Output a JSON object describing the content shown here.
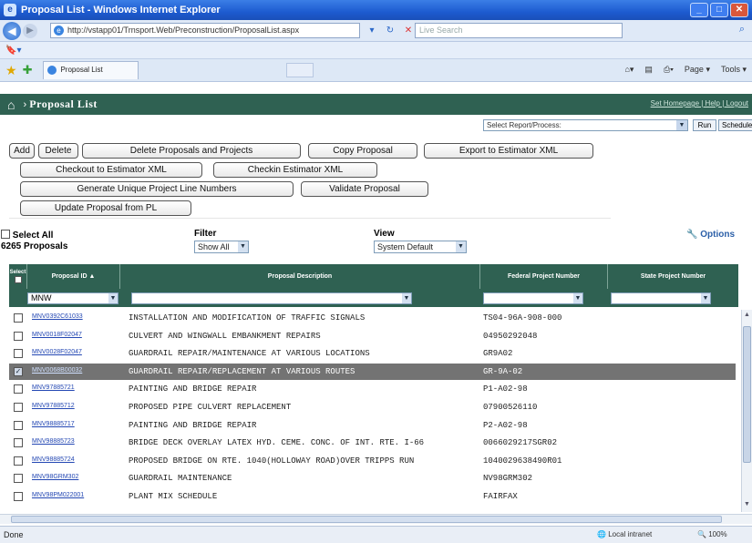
{
  "window": {
    "title": "Proposal List - Windows Internet Explorer",
    "address": "http://vstapp01/Trnsport.Web/Preconstruction/ProposalList.aspx",
    "search_placeholder": "Live Search",
    "tab_label": "Proposal List",
    "tools": [
      "Page ▾",
      "Tools ▾"
    ]
  },
  "app": {
    "title": "Proposal List",
    "header_links": "Set Homepage | Help | Logout",
    "report_select": "Select Report/Process:",
    "run_label": "Run",
    "schedule_label": "Schedule"
  },
  "actions": {
    "add": "Add",
    "delete": "Delete",
    "delete_proposals_projects": "Delete Proposals and Projects",
    "copy_proposal": "Copy Proposal",
    "export_estimator": "Export to Estimator XML",
    "checkout_estimator": "Checkout to Estimator XML",
    "checkin_estimator": "Checkin Estimator XML",
    "generate_line_numbers": "Generate Unique Project Line Numbers",
    "validate_proposal": "Validate Proposal",
    "update_from_pl": "Update Proposal from PL"
  },
  "controls": {
    "select_all": "Select All",
    "count": "6265 Proposals",
    "filter_label": "Filter",
    "filter_value": "Show All",
    "view_label": "View",
    "view_value": "System Default",
    "options": "Options"
  },
  "grid": {
    "headers": {
      "select": "Select",
      "proposal_id": "Proposal ID ▲",
      "description": "Proposal Description",
      "federal": "Federal Project Number",
      "state": "State Project Number"
    },
    "filter_proposal_id": "MNW",
    "rows": [
      {
        "id": "MNV0392C61033",
        "desc": "INSTALLATION AND MODIFICATION OF TRAFFIC SIGNALS",
        "fed": "TS04-96A-908-000",
        "state": "",
        "selected": false
      },
      {
        "id": "MNV0018F02047",
        "desc": "CULVERT AND WINGWALL EMBANKMENT REPAIRS",
        "fed": "04950292048",
        "state": "",
        "selected": false
      },
      {
        "id": "MNV0028F02047",
        "desc": "GUARDRAIL REPAIR/MAINTENANCE AT VARIOUS LOCATIONS",
        "fed": "GR9A02",
        "state": "",
        "selected": false
      },
      {
        "id": "MNV0068B00032",
        "desc": "GUARDRAIL REPAIR/REPLACEMENT AT VARIOUS ROUTES",
        "fed": "GR-9A-02",
        "state": "",
        "selected": true
      },
      {
        "id": "MNV97885721",
        "desc": "PAINTING AND BRIDGE REPAIR",
        "fed": "P1-A02-98",
        "state": "",
        "selected": false
      },
      {
        "id": "MNV97885712",
        "desc": "PROPOSED PIPE CULVERT REPLACEMENT",
        "fed": "07900526110",
        "state": "",
        "selected": false
      },
      {
        "id": "MNV98885717",
        "desc": "PAINTING AND BRIDGE REPAIR",
        "fed": "P2-A02-98",
        "state": "",
        "selected": false
      },
      {
        "id": "MNV98885723",
        "desc": "BRIDGE DECK OVERLAY LATEX HYD. CEME. CONC. OF INT. RTE. I-66",
        "fed": "0066029217SGR02",
        "state": "",
        "selected": false
      },
      {
        "id": "MNV98885724",
        "desc": "PROPOSED BRIDGE ON RTE. 1040(HOLLOWAY ROAD)OVER TRIPPS RUN",
        "fed": "1040029638490R01",
        "state": "",
        "selected": false
      },
      {
        "id": "MNV98GRM302",
        "desc": "GUARDRAIL MAINTENANCE",
        "fed": "NV98GRM302",
        "state": "",
        "selected": false
      },
      {
        "id": "MNV98PM022001",
        "desc": "PLANT MIX SCHEDULE",
        "fed": "FAIRFAX",
        "state": "",
        "selected": false
      }
    ]
  },
  "status": {
    "left": "Done",
    "zone": "Local intranet",
    "zoom": "100%"
  },
  "colors": {
    "header_green": "#2f6152",
    "selected_row": "#737373",
    "ie_blue": "#1d5bd0"
  }
}
